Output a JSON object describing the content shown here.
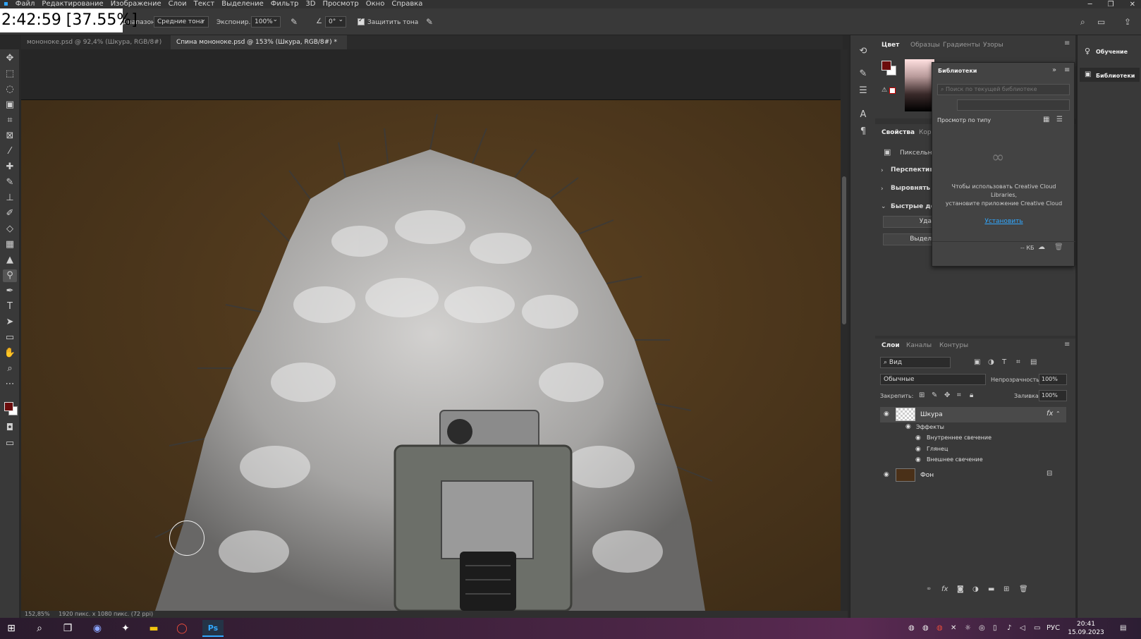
{
  "menu": [
    "Файл",
    "Редактирование",
    "Изображение",
    "Слои",
    "Текст",
    "Выделение",
    "Фильтр",
    "3D",
    "Просмотр",
    "Окно",
    "Справка"
  ],
  "overlay_timer": "2:42:59 [37.55%]",
  "options": {
    "range_label": "Диапазон:",
    "range_value": "Средние тона",
    "exposure_label": "Экспонир.:",
    "exposure_value": "100%",
    "angle_value": "0°",
    "protect_tones_label": "Защитить тона",
    "protect_tones_checked": true
  },
  "tabs": [
    {
      "label": "мононоке.psd @ 92,4% (Шкура, RGB/8#) *",
      "active": false
    },
    {
      "label": "Спина мононоке.psd @ 153% (Шкура, RGB/8#) *",
      "active": true
    }
  ],
  "status": {
    "zoom": "152,85%",
    "doc_info": "1920 пикс. x 1080 пикс. (72 ppi)"
  },
  "color_panel": {
    "tabs": [
      "Цвет",
      "Образцы",
      "Градиенты",
      "Узоры"
    ],
    "foreground": "#6b0c0c",
    "background": "#ffffff"
  },
  "properties_panel": {
    "tabs": [
      "Свойства",
      "Корр"
    ],
    "type_label": "Пиксельный",
    "sections": [
      "Перспектива",
      "Выровнять и",
      "Быстрые дей"
    ],
    "buttons": [
      "Уда",
      "Выдел"
    ]
  },
  "libraries": {
    "title": "Библиотеки",
    "search_placeholder": "Поиск по текущей библиотеке",
    "view_label": "Просмотр по типу",
    "message_line1": "Чтобы использовать Creative Cloud",
    "message_line2": "Libraries,",
    "message_line3": "установите приложение Creative Cloud",
    "install_link": "Установить",
    "size_label": "-- КБ"
  },
  "learn_column": {
    "learn_label": "Обучение",
    "libraries_label": "Библиотеки"
  },
  "layers_panel": {
    "tabs": [
      "Слои",
      "Каналы",
      "Контуры"
    ],
    "filter_label": "Вид",
    "blend_mode": "Обычные",
    "opacity_label": "Непрозрачность:",
    "opacity_value": "100%",
    "lock_label": "Закрепить:",
    "fill_label": "Заливка:",
    "fill_value": "100%",
    "layers": [
      {
        "name": "Шкура",
        "fx": "fx"
      },
      {
        "name": "Фон"
      }
    ],
    "effects_label": "Эффекты",
    "effects": [
      "Внутреннее свечение",
      "Глянец",
      "Внешнее свечение"
    ]
  },
  "taskbar": {
    "time": "20:41",
    "date": "15.09.2023",
    "lang": "РУС"
  },
  "accent": "#31a8ff"
}
